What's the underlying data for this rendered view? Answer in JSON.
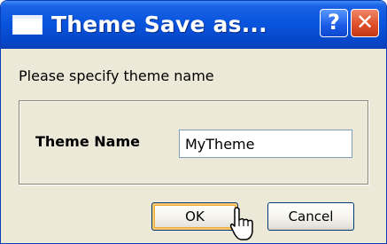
{
  "window": {
    "title": "Theme Save as...",
    "icons": {
      "app": "window-icon",
      "help": "help-icon",
      "close": "close-icon"
    },
    "help_label": "?",
    "close_label": "✕"
  },
  "dialog": {
    "prompt": "Please specify theme name",
    "theme_name_label": "Theme Name",
    "theme_name_value": "MyTheme"
  },
  "buttons": {
    "ok": "OK",
    "cancel": "Cancel"
  },
  "colors": {
    "titlebar": "#0a55de",
    "close": "#de5028",
    "face": "#ece9d8",
    "focus": "#f2a93b"
  }
}
